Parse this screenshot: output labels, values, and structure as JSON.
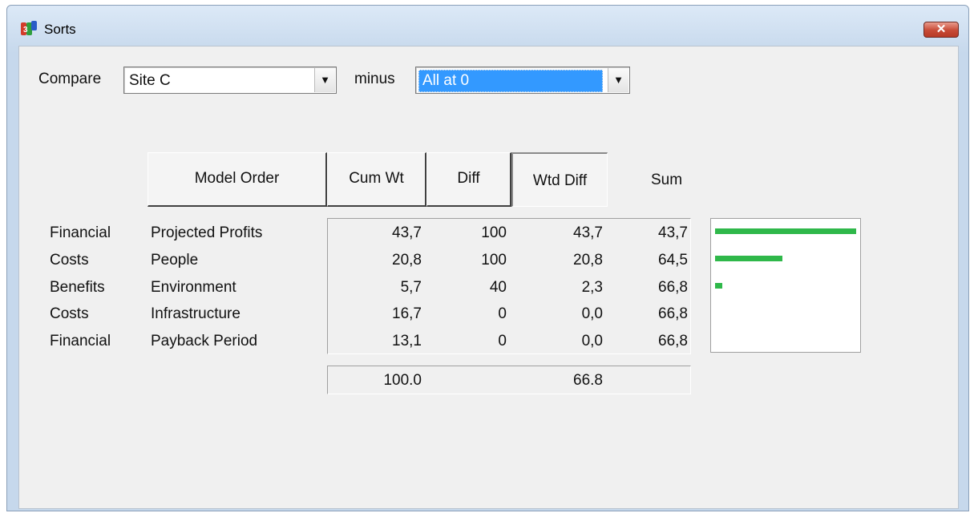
{
  "window": {
    "title": "Sorts",
    "close_label": "✕",
    "app_icon": "hiview-app-icon"
  },
  "compare": {
    "label": "Compare",
    "left_value": "Site C",
    "minus_label": "minus",
    "right_value": "All at 0"
  },
  "headers": {
    "model_order": "Model Order",
    "cum_wt": "Cum Wt",
    "diff": "Diff",
    "wtd_diff": "Wtd Diff",
    "sum": "Sum"
  },
  "rows": [
    {
      "category": "Financial",
      "criterion": "Projected Profits",
      "cum_wt": "43,7",
      "diff": "100",
      "wtd_diff": "43,7",
      "sum": "43,7",
      "bar_fraction": 1.0
    },
    {
      "category": "Costs",
      "criterion": "People",
      "cum_wt": "20,8",
      "diff": "100",
      "wtd_diff": "20,8",
      "sum": "64,5",
      "bar_fraction": 0.476
    },
    {
      "category": "Benefits",
      "criterion": "Environment",
      "cum_wt": "5,7",
      "diff": "40",
      "wtd_diff": "2,3",
      "sum": "66,8",
      "bar_fraction": 0.053
    },
    {
      "category": "Costs",
      "criterion": "Infrastructure",
      "cum_wt": "16,7",
      "diff": "0",
      "wtd_diff": "0,0",
      "sum": "66,8",
      "bar_fraction": 0
    },
    {
      "category": "Financial",
      "criterion": "Payback Period",
      "cum_wt": "13,1",
      "diff": "0",
      "wtd_diff": "0,0",
      "sum": "66,8",
      "bar_fraction": 0
    }
  ],
  "totals": {
    "cum_wt": "100.0",
    "wtd_diff": "66.8"
  },
  "colors": {
    "bar": "#2fb84a",
    "selection": "#3399ff",
    "close": "#c74a36"
  }
}
